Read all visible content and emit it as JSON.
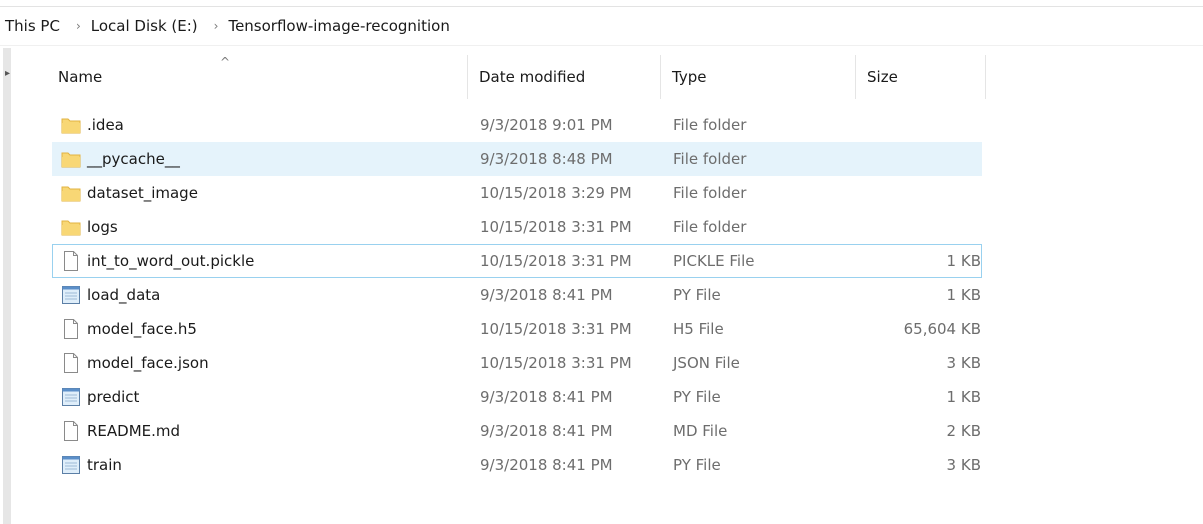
{
  "breadcrumb": {
    "items": [
      "This PC",
      "Local Disk (E:)",
      "Tensorflow-image-recognition"
    ],
    "separator": "›"
  },
  "columns": {
    "name": "Name",
    "date": "Date modified",
    "type": "Type",
    "size": "Size",
    "sort_indicator": "^"
  },
  "rows": [
    {
      "name": ".idea",
      "date": "9/3/2018 9:01 PM",
      "type": "File folder",
      "size": "",
      "icon": "folder-icon",
      "state": "normal"
    },
    {
      "name": "__pycache__",
      "date": "9/3/2018 8:48 PM",
      "type": "File folder",
      "size": "",
      "icon": "folder-icon",
      "state": "hover"
    },
    {
      "name": "dataset_image",
      "date": "10/15/2018 3:29 PM",
      "type": "File folder",
      "size": "",
      "icon": "folder-icon",
      "state": "normal"
    },
    {
      "name": "logs",
      "date": "10/15/2018 3:31 PM",
      "type": "File folder",
      "size": "",
      "icon": "folder-icon",
      "state": "normal"
    },
    {
      "name": "int_to_word_out.pickle",
      "date": "10/15/2018 3:31 PM",
      "type": "PICKLE File",
      "size": "1 KB",
      "icon": "file-icon",
      "state": "focused"
    },
    {
      "name": "load_data",
      "date": "9/3/2018 8:41 PM",
      "type": "PY File",
      "size": "1 KB",
      "icon": "python-file-icon",
      "state": "normal"
    },
    {
      "name": "model_face.h5",
      "date": "10/15/2018 3:31 PM",
      "type": "H5 File",
      "size": "65,604 KB",
      "icon": "file-icon",
      "state": "normal"
    },
    {
      "name": "model_face.json",
      "date": "10/15/2018 3:31 PM",
      "type": "JSON File",
      "size": "3 KB",
      "icon": "file-icon",
      "state": "normal"
    },
    {
      "name": "predict",
      "date": "9/3/2018 8:41 PM",
      "type": "PY File",
      "size": "1 KB",
      "icon": "python-file-icon",
      "state": "normal"
    },
    {
      "name": "README.md",
      "date": "9/3/2018 8:41 PM",
      "type": "MD File",
      "size": "2 KB",
      "icon": "file-icon",
      "state": "normal"
    },
    {
      "name": "train",
      "date": "9/3/2018 8:41 PM",
      "type": "PY File",
      "size": "3 KB",
      "icon": "python-file-icon",
      "state": "normal"
    }
  ],
  "colors": {
    "hover_background": "#e5f3fb",
    "focus_border": "#99d1ef",
    "folder_yellow": "#f8d775",
    "folder_dark": "#e2b341"
  }
}
